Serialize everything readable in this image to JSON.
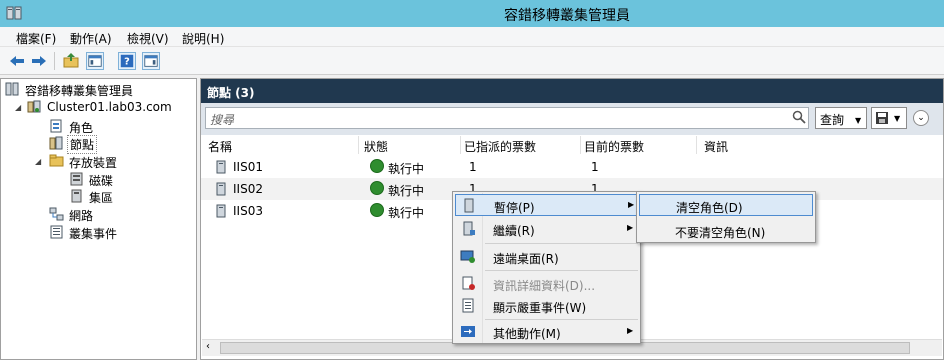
{
  "window": {
    "title": "容錯移轉叢集管理員"
  },
  "menubar": [
    "檔案(F)",
    "動作(A)",
    "檢視(V)",
    "說明(H)"
  ],
  "tree": {
    "root": "容錯移轉叢集管理員",
    "cluster": "Cluster01.lab03.com",
    "roles": "角色",
    "nodes": "節點",
    "storage": "存放裝置",
    "disks": "磁碟",
    "pools": "集區",
    "networks": "網路",
    "events": "叢集事件"
  },
  "pane": {
    "title": "節點 (3)",
    "search_placeholder": "搜尋",
    "query_label": "查詢"
  },
  "columns": [
    "名稱",
    "狀態",
    "已指派的票數",
    "目前的票數",
    "資訊"
  ],
  "rows": [
    {
      "name": "IIS01",
      "status": "執行中",
      "assigned": "1",
      "current": "1",
      "info": ""
    },
    {
      "name": "IIS02",
      "status": "執行中",
      "assigned": "1",
      "current": "1",
      "info": ""
    },
    {
      "name": "IIS03",
      "status": "執行中",
      "assigned": "",
      "current": "",
      "info": ""
    }
  ],
  "context_menu": {
    "pause": "暫停(P)",
    "resume": "繼續(R)",
    "remote_desktop": "遠端桌面(R)",
    "info_details": "資訊詳細資料(D)...",
    "critical_events": "顯示嚴重事件(W)",
    "more_actions": "其他動作(M)"
  },
  "submenu": {
    "drain_roles": "清空角色(D)",
    "do_not_drain": "不要清空角色(N)"
  },
  "colors": {
    "title_bar": "#6bc3dc",
    "pane_header": "#20384f",
    "highlight": "#dbe9f7"
  }
}
